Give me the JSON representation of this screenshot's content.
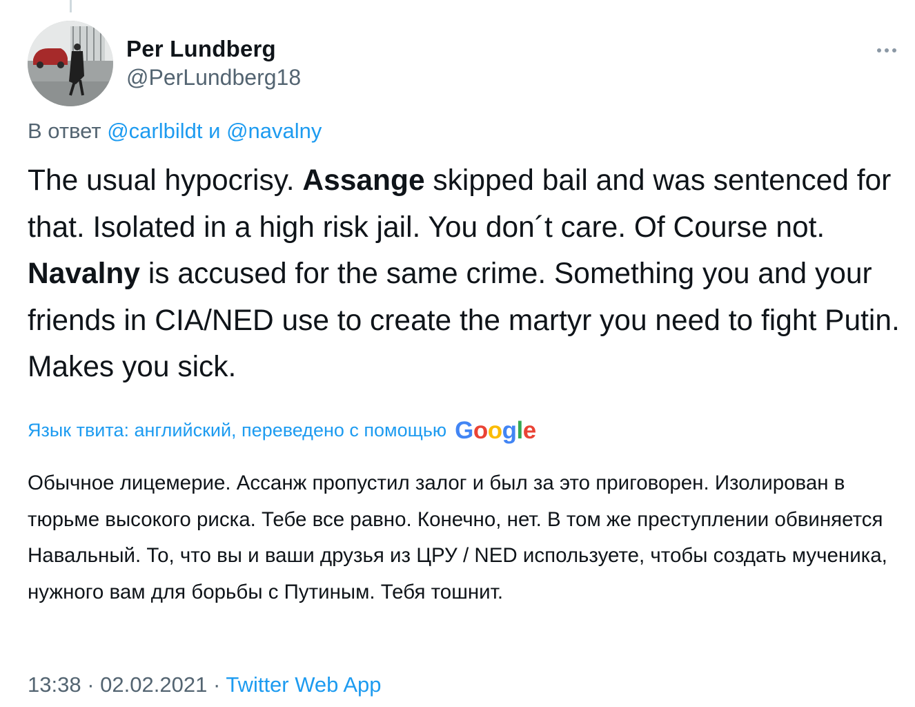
{
  "author": {
    "display_name": "Per Lundberg",
    "handle": "@PerLundberg18"
  },
  "more_icon": "more-horizontal-icon",
  "reply": {
    "prefix": "В ответ",
    "mention_1": "@carlbildt",
    "conjunction": "и",
    "mention_2": "@navalny"
  },
  "tweet": {
    "segments": [
      "The usual hypocrisy. ",
      "Assange",
      " skipped bail and was sentenced for that. Isolated in a high risk jail. You don´t care. Of Course not. ",
      "Navalny",
      " is accused for the same crime. Something you and your friends in CIA/NED use to create the martyr you need to fight Putin. Makes you sick."
    ]
  },
  "translation": {
    "label": "Язык твита: английский, переведено с помощью",
    "provider_letters": [
      "G",
      "o",
      "o",
      "g",
      "l",
      "e"
    ],
    "text": "Обычное лицемерие. Ассанж пропустил залог и был за это приговорен. Изолирован в тюрьме высокого риска. Тебе все равно. Конечно, нет. В том же преступлении обвиняется Навальный. То, что вы и ваши друзья из ЦРУ / NED используете, чтобы создать мученика, нужного вам для борьбы с Путиным. Тебя тошнит."
  },
  "meta": {
    "time": "13:38",
    "separator_1": "·",
    "date": "02.02.2021",
    "separator_2": "·",
    "source": "Twitter Web App"
  },
  "colors": {
    "text": "#0f1419",
    "secondary": "#536471",
    "link": "#1d9bf0"
  }
}
